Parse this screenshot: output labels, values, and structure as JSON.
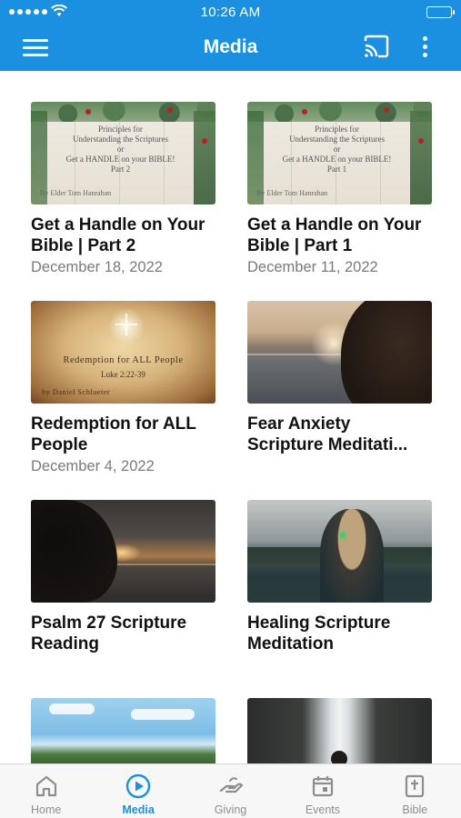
{
  "status_bar": {
    "time": "10:26 AM"
  },
  "nav": {
    "title": "Media",
    "menu_icon": "hamburger-menu-icon",
    "cast_icon": "cast-icon",
    "more_icon": "more-vertical-icon"
  },
  "colors": {
    "accent": "#1b8fe0",
    "tab_inactive": "#8e8e8e",
    "date_text": "#7a7a7a"
  },
  "thumb_text": {
    "principles_lines": [
      "Principles for",
      "Understanding the Scriptures",
      "or",
      "Get a HANDLE on your BIBLE!"
    ],
    "principles_part2": "Part 2",
    "principles_part1": "Part 1",
    "principles_author": "By Elder Tom Hanrahan",
    "redemption_title": "Redemption for ALL People",
    "redemption_ref": "Luke 2:22-39",
    "redemption_by": "by Daniel Schlueter"
  },
  "media": [
    {
      "title": "Get a Handle on Your Bible | Part 2",
      "date": "December 18, 2022",
      "thumb": "principles-part2"
    },
    {
      "title": "Get a Handle on Your Bible | Part 1",
      "date": "December 11, 2022",
      "thumb": "principles-part1"
    },
    {
      "title": "Redemption for ALL People",
      "date": "December 4, 2022",
      "thumb": "redemption"
    },
    {
      "title": "Fear Anxiety Scripture Meditati...",
      "date": "",
      "thumb": "ocean-hair"
    },
    {
      "title": "Psalm 27 Scripture Reading",
      "date": "",
      "thumb": "sunset-lake"
    },
    {
      "title": "Healing Scripture Meditation",
      "date": "",
      "thumb": "girl-lake"
    },
    {
      "title": "",
      "date": "",
      "thumb": "mountain-lake"
    },
    {
      "title": "",
      "date": "",
      "thumb": "waterfall"
    }
  ],
  "tabs": [
    {
      "label": "Home",
      "icon": "home-icon"
    },
    {
      "label": "Media",
      "icon": "play-circle-icon",
      "active": true
    },
    {
      "label": "Giving",
      "icon": "giving-hand-icon"
    },
    {
      "label": "Events",
      "icon": "calendar-icon"
    },
    {
      "label": "Bible",
      "icon": "bible-book-icon"
    }
  ]
}
